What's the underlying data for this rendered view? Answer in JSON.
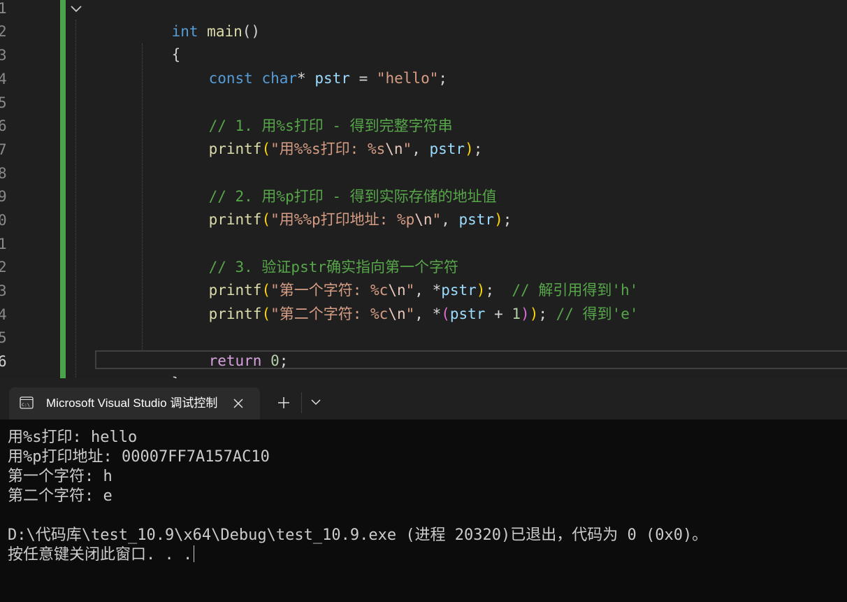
{
  "editor": {
    "line_numbers": [
      "1",
      "2",
      "3",
      "4",
      "5",
      "6",
      "7",
      "8",
      "9",
      "0",
      "1",
      "2",
      "3",
      "4",
      "5",
      "6"
    ],
    "current_line_number": "6",
    "lines": {
      "l1": {
        "kw": "int",
        "fn": "main",
        "paren": "()"
      },
      "l2": {
        "brace": "{"
      },
      "l3": {
        "kw1": "const",
        "kw2": "char",
        "star": "*",
        "var": "pstr",
        "eq": " = ",
        "str": "\"hello\"",
        "semi": ";"
      },
      "l5": {
        "comment": "// 1. 用%s打印 - 得到完整字符串"
      },
      "l6": {
        "fn": "printf",
        "open": "(",
        "str1": "\"用%%s打印: %s",
        "esc": "\\n",
        "str2": "\"",
        "comma": ", ",
        "var": "pstr",
        "close": ")",
        "semi": ";"
      },
      "l8": {
        "comment": "// 2. 用%p打印 - 得到实际存储的地址值"
      },
      "l9": {
        "fn": "printf",
        "open": "(",
        "str1": "\"用%%p打印地址: %p",
        "esc": "\\n",
        "str2": "\"",
        "comma": ", ",
        "var": "pstr",
        "close": ")",
        "semi": ";"
      },
      "l11": {
        "comment": "// 3. 验证pstr确实指向第一个字符"
      },
      "l12": {
        "fn": "printf",
        "open": "(",
        "str1": "\"第一个字符: %c",
        "esc": "\\n",
        "str2": "\"",
        "comma": ", ",
        "star": "*",
        "var": "pstr",
        "close": ")",
        "semi": ";",
        "comment": "  // 解引用得到'h'"
      },
      "l13": {
        "fn": "printf",
        "open": "(",
        "str1": "\"第二个字符: %c",
        "esc": "\\n",
        "str2": "\"",
        "comma": ", ",
        "star": "*",
        "open2": "(",
        "var": "pstr",
        "plus": " + ",
        "num": "1",
        "close2": ")",
        "close": ")",
        "semi": ";",
        "comment": " // 得到'e'"
      },
      "l15": {
        "kw": "return",
        "num": "0",
        "semi": ";"
      },
      "l16": {
        "brace": "}"
      }
    }
  },
  "terminal": {
    "tab_title": "Microsoft Visual Studio 调试控制台",
    "output": [
      "用%s打印: hello",
      "用%p打印地址: 00007FF7A157AC10",
      "第一个字符: h",
      "第二个字符: e",
      "",
      "D:\\代码库\\test_10.9\\x64\\Debug\\test_10.9.exe (进程 20320)已退出，代码为 0 (0x0)。",
      "按任意键关闭此窗口. . ."
    ]
  },
  "icons": {
    "fold": "chevron-down-icon",
    "tab": "console-icon",
    "close": "close-icon",
    "new_tab": "plus-icon",
    "dropdown": "chevron-down-icon"
  },
  "colors": {
    "editor_bg": "#1f1f1f",
    "change_bar": "#4aa34a",
    "keyword": "#569cd6",
    "function": "#dcdcaa",
    "variable": "#9cdcfe",
    "string": "#d69d85",
    "comment": "#57a64a",
    "terminal_bg": "#0c0c0c"
  }
}
